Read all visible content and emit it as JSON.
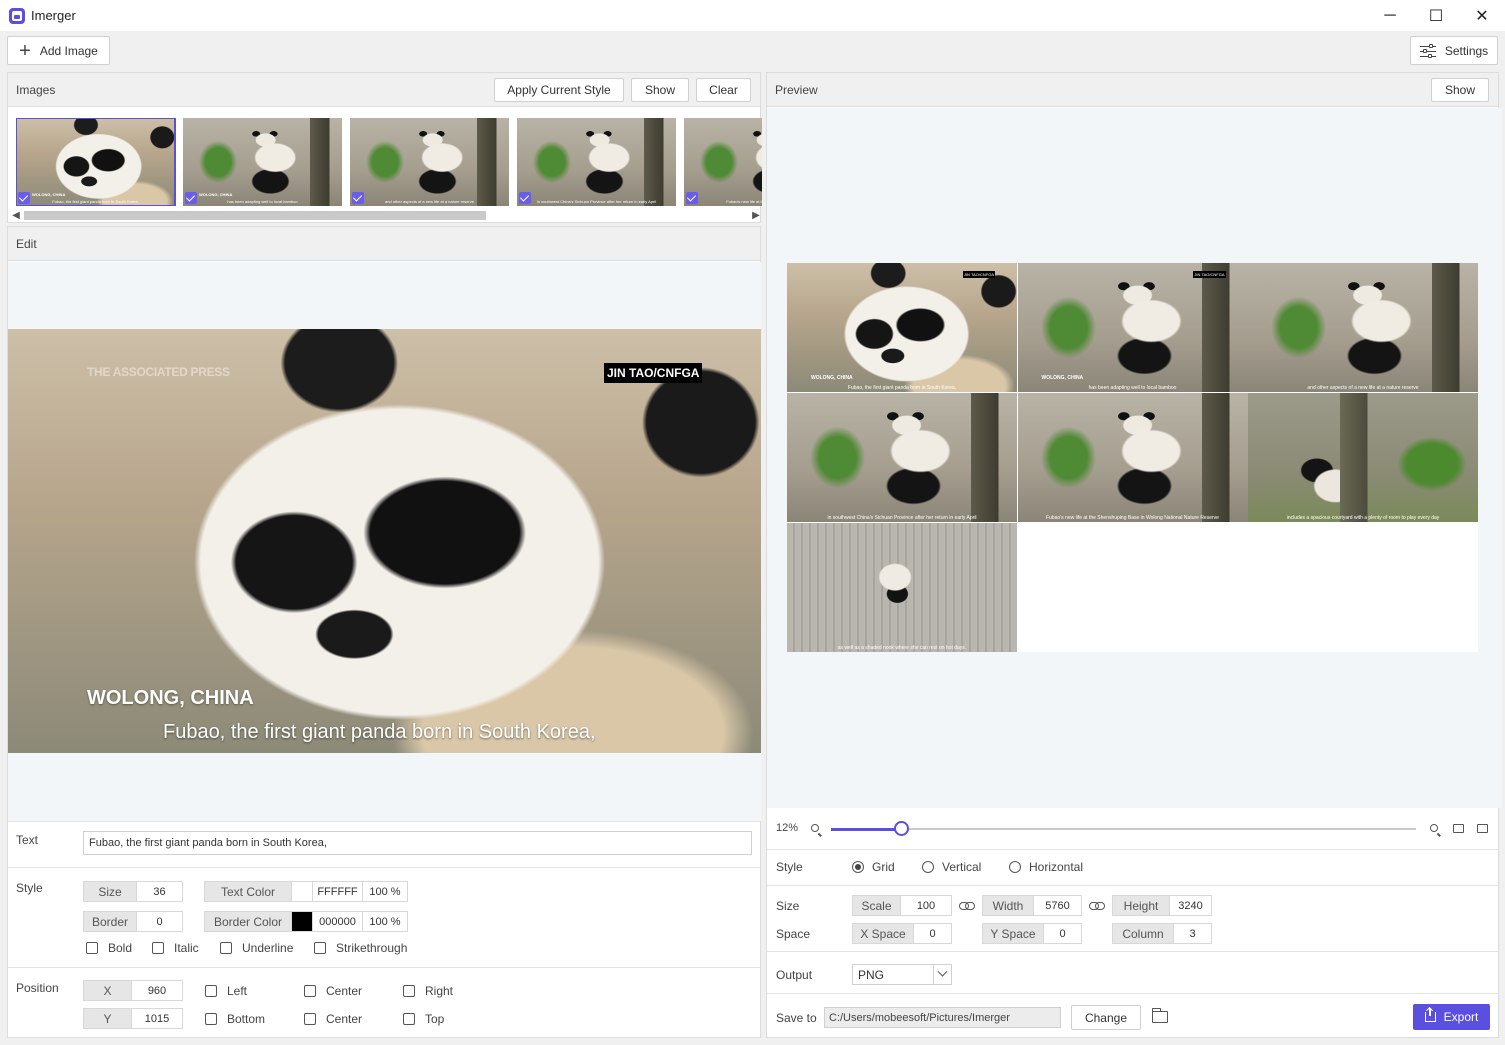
{
  "window": {
    "title": "Imerger",
    "minimize": "─",
    "maximize": "☐",
    "close": "✕"
  },
  "toolbar": {
    "add_image": "Add Image",
    "settings": "Settings"
  },
  "images_panel": {
    "title": "Images",
    "apply_style": "Apply Current Style",
    "show": "Show",
    "clear": "Clear",
    "thumbnails": [
      {
        "scene": "closeup",
        "location": "WOLONG, CHINA",
        "caption": "Fubao, the first giant panda born in South Korea,"
      },
      {
        "scene": "bamboo",
        "location": "WOLONG, CHINA",
        "caption": "has been adapting well to local bamboo"
      },
      {
        "scene": "bamboo",
        "location": "",
        "caption": "and other aspects of a new life at a nature reserve"
      },
      {
        "scene": "bamboo",
        "location": "",
        "caption": "in southwest China's Sichuan Province after her return in early April"
      },
      {
        "scene": "bamboo",
        "location": "",
        "caption": "Fubao's new life at the Shenshuping Base"
      }
    ]
  },
  "edit_panel": {
    "title": "Edit",
    "watermark": "THE ASSOCIATED PRESS",
    "credit": "JIN TAO/CNFGA",
    "location": "WOLONG, CHINA",
    "caption": "Fubao, the first giant panda born in South Korea,",
    "text_label": "Text",
    "text_value": "Fubao, the first giant panda born in South Korea,",
    "style_label": "Style",
    "size_label": "Size",
    "size_value": "36",
    "text_color_label": "Text Color",
    "text_color_hex": "FFFFFF",
    "text_color_opacity": "100 %",
    "border_label": "Border",
    "border_value": "0",
    "border_color_label": "Border Color",
    "border_color_hex": "000000",
    "border_color_opacity": "100 %",
    "bold": "Bold",
    "italic": "Italic",
    "underline": "Underline",
    "strikethrough": "Strikethrough",
    "position_label": "Position",
    "x_label": "X",
    "x_value": "960",
    "y_label": "Y",
    "y_value": "1015",
    "left": "Left",
    "center_h": "Center",
    "right": "Right",
    "bottom": "Bottom",
    "center_v": "Center",
    "top": "Top",
    "colors": {
      "text": "#FFFFFF",
      "border": "#000000"
    }
  },
  "preview_panel": {
    "title": "Preview",
    "show": "Show",
    "grid_cells": [
      {
        "scene": "closeup",
        "location": "WOLONG, CHINA",
        "tag": "JIN TAO/CNFGA",
        "caption": "Fubao, the first giant panda born in South Korea,"
      },
      {
        "scene": "bamboo",
        "location": "WOLONG, CHINA",
        "tag": "JIN TAO/CNFGA",
        "caption": "has been adapting well to local bamboo"
      },
      {
        "scene": "bamboo",
        "location": "",
        "tag": "",
        "caption": "and other aspects of a new life at a nature reserve"
      },
      {
        "scene": "bamboo",
        "location": "",
        "tag": "",
        "caption": "in southwest China's Sichuan Province after her return in early April"
      },
      {
        "scene": "bamboo",
        "location": "",
        "tag": "",
        "caption": "Fubao's new life at the Shenshuping Base in Wolong National Nature Reserve"
      },
      {
        "scene": "lying",
        "location": "",
        "tag": "",
        "caption": "includes a spacious courtyard with a plenty of room to play every day"
      },
      {
        "scene": "wall",
        "location": "",
        "tag": "",
        "caption": "as well as a shaded nook where she can rest on hot days."
      }
    ],
    "zoom_label": "12%",
    "zoom_fraction": 0.12,
    "style_label": "Style",
    "layout_grid": "Grid",
    "layout_vertical": "Vertical",
    "layout_horizontal": "Horizontal",
    "size_label": "Size",
    "scale_label": "Scale",
    "scale_value": "100",
    "width_label": "Width",
    "width_value": "5760",
    "height_label": "Height",
    "height_value": "3240",
    "space_label": "Space",
    "xspace_label": "X Space",
    "xspace_value": "0",
    "yspace_label": "Y Space",
    "yspace_value": "0",
    "column_label": "Column",
    "column_value": "3",
    "output_label": "Output",
    "output_value": "PNG",
    "save_label": "Save to",
    "save_path": "C:/Users/mobeesoft/Pictures/Imerger",
    "change": "Change",
    "export": "Export",
    "accent": "#5B4FE0"
  }
}
